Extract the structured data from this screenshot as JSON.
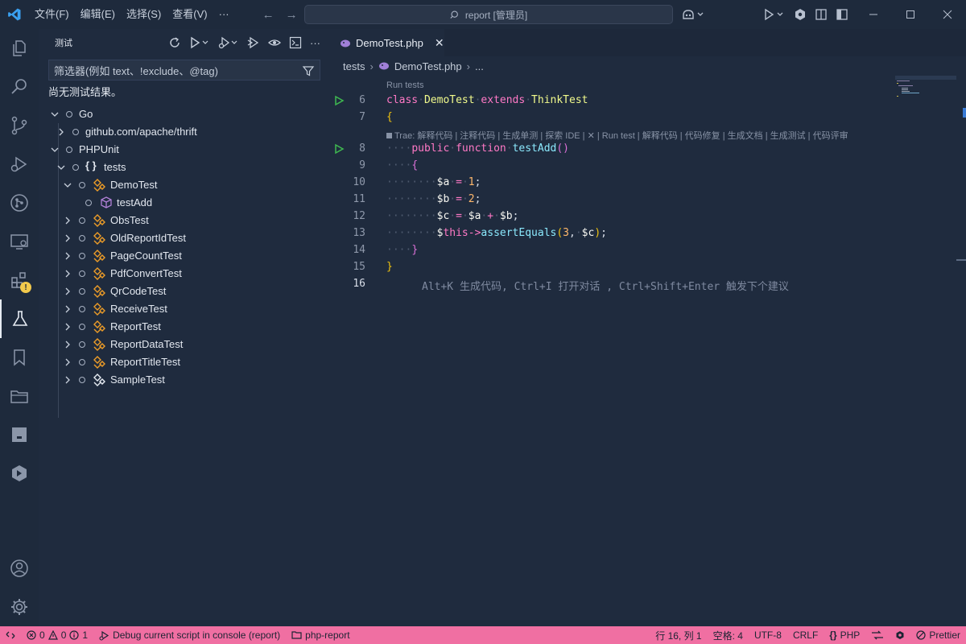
{
  "titlebar": {
    "menus": [
      "文件(F)",
      "编辑(E)",
      "选择(S)",
      "查看(V)",
      "···"
    ],
    "search_text": "report [管理员]"
  },
  "sidebar": {
    "title": "测试",
    "filter_placeholder": "筛选器(例如 text、!exclude、@tag)",
    "no_results": "尚无测试结果。",
    "tree": [
      {
        "label": "Go",
        "expanded": true
      },
      {
        "label": "github.com/apache/thrift",
        "expanded": false
      },
      {
        "label": "PHPUnit",
        "expanded": true
      },
      {
        "label": "tests",
        "expanded": true
      },
      {
        "label": "DemoTest",
        "expanded": true
      },
      {
        "label": "testAdd"
      },
      {
        "label": "ObsTest"
      },
      {
        "label": "OldReportIdTest"
      },
      {
        "label": "PageCountTest"
      },
      {
        "label": "PdfConvertTest"
      },
      {
        "label": "QrCodeTest"
      },
      {
        "label": "ReceiveTest"
      },
      {
        "label": "ReportTest"
      },
      {
        "label": "ReportDataTest"
      },
      {
        "label": "ReportTitleTest"
      },
      {
        "label": "SampleTest"
      }
    ]
  },
  "editor": {
    "tab_label": "DemoTest.php",
    "breadcrumb": [
      "tests",
      "DemoTest.php",
      "..."
    ],
    "run_tests_lens": "Run tests",
    "trae_lens": "Trae: 解释代码 | 注释代码 | 生成单测 | 探索 IDE | ✕ | Run test | 解释代码 | 代码修复 | 生成文档 | 生成测试 | 代码评审",
    "line_numbers": [
      "6",
      "7",
      "8",
      "9",
      "10",
      "11",
      "12",
      "13",
      "14",
      "15",
      "16"
    ],
    "hint": "Alt+K 生成代码, Ctrl+I 打开对话 , Ctrl+Shift+Enter 触发下个建议"
  },
  "statusbar": {
    "problems_errors": "0",
    "problems_warnings": "0",
    "problems_info": "1",
    "debug": "Debug current script in console (report)",
    "folder": "php-report",
    "cursor": "行 16, 列 1",
    "spaces": "空格: 4",
    "encoding": "UTF-8",
    "eol": "CRLF",
    "language": "PHP",
    "formatter": "Prettier"
  }
}
